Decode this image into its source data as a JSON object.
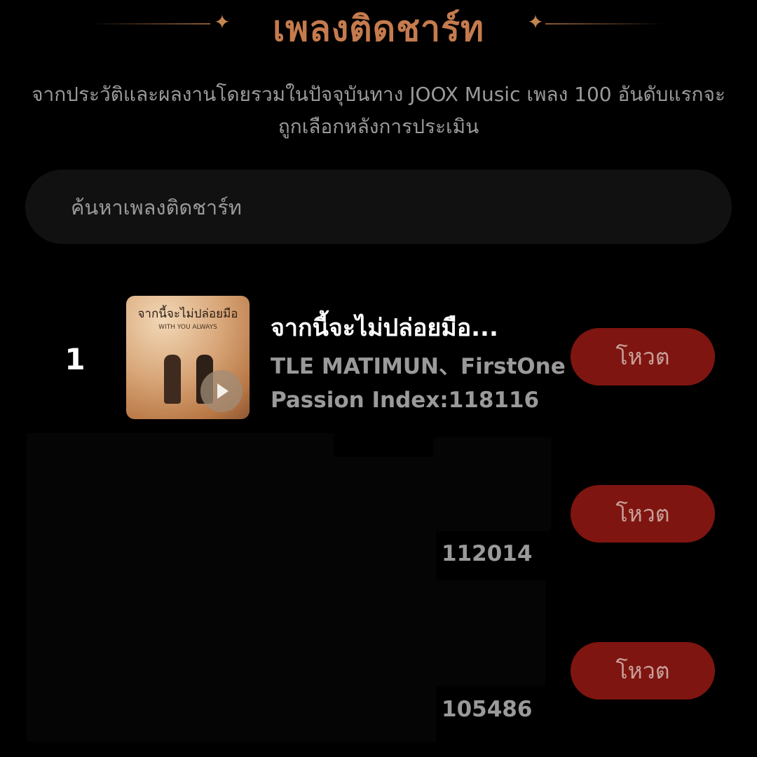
{
  "header": {
    "title": "เพลงติดชาร์ท",
    "star_glyph": "✦"
  },
  "subtitle": "จากประวัติและผลงานโดยรวมในปัจจุบันทาง JOOX Music เพลง 100 อันดับแรกจะถูกเลือกหลังการประเมิน",
  "search": {
    "placeholder": "ค้นหาเพลงติดชาร์ท"
  },
  "chart_list": [
    {
      "rank": "1",
      "cover_title": "จากนี้จะไม่ปล่อยมือ",
      "cover_subtitle": "WITH YOU ALWAYS",
      "title": "จากนี้จะไม่ปล่อยมือ...",
      "artist": "TLE MATIMUN、FirstOne",
      "passion": "Passion Index:118116",
      "vote_label": "โหวต"
    },
    {
      "passion_value": "112014",
      "vote_label": "โหวต"
    },
    {
      "passion_value": "105486",
      "vote_label": "โหวต"
    }
  ],
  "colors": {
    "background": "#000000",
    "title_accent": "#c57b4e",
    "vote_button": "#7f1510",
    "muted_text": "#9a9a9a"
  }
}
